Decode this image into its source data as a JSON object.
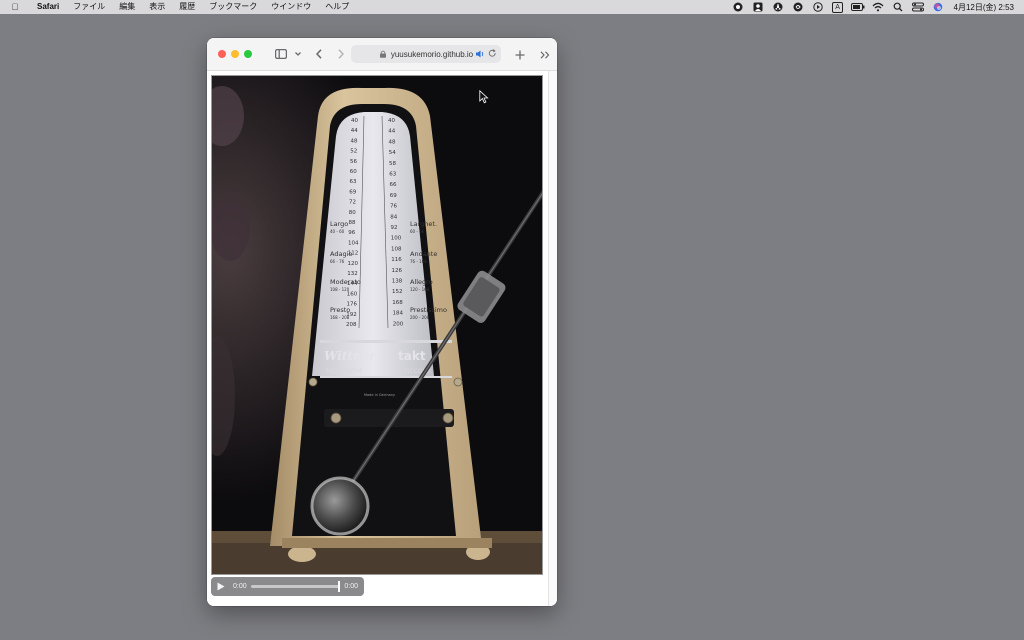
{
  "menubar": {
    "app_name": "Safari",
    "items": [
      "ファイル",
      "編集",
      "表示",
      "履歴",
      "ブックマーク",
      "ウインドウ",
      "ヘルプ"
    ],
    "clock": "4月12日(金)  2:53",
    "status_icons": [
      "record-icon",
      "user-icon",
      "radiation-icon",
      "dial-icon",
      "play-circle-icon",
      "input-method-icon",
      "battery-icon",
      "wifi-icon",
      "search-icon",
      "control-center-icon",
      "siri-icon"
    ],
    "input_method_label": "A"
  },
  "browser": {
    "url": "yuusukemorio.github.io",
    "colors": {
      "close": "#fe5f57",
      "minimize": "#febc2e",
      "zoom": "#28c840"
    }
  },
  "video": {
    "subject": "metronome",
    "brand_left": "Wittner",
    "brand_left_sub": "METRONOM",
    "brand_right": "takt",
    "brand_right_sub": "PICCOLO",
    "made_in": "Made in Germany",
    "tempo_left": [
      "40",
      "44",
      "48",
      "52",
      "56",
      "60",
      "63",
      "69",
      "72",
      "80",
      "88",
      "96",
      "104",
      "112",
      "120",
      "132",
      "144",
      "160",
      "176",
      "192",
      "208"
    ],
    "tempo_right": [
      "40",
      "44",
      "48",
      "54",
      "58",
      "63",
      "66",
      "69",
      "76",
      "84",
      "92",
      "100",
      "108",
      "116",
      "126",
      "138",
      "152",
      "168",
      "184",
      "200"
    ],
    "markings_left": [
      {
        "name": "Largo",
        "range": "40 - 60"
      },
      {
        "name": "Adagio",
        "range": "66 - 76"
      },
      {
        "name": "Moderato",
        "range": "108 - 120"
      },
      {
        "name": "Presto",
        "range": "168 - 208"
      }
    ],
    "markings_right": [
      {
        "name": "Larghet.",
        "range": "60 - 66"
      },
      {
        "name": "Andante",
        "range": "76 - 108"
      },
      {
        "name": "Allegro",
        "range": "120 - 168"
      },
      {
        "name": "Prestissimo",
        "range": "200 - 208"
      }
    ]
  },
  "player": {
    "current_time": "0:00",
    "duration": "0:00",
    "progress": 1.0
  }
}
